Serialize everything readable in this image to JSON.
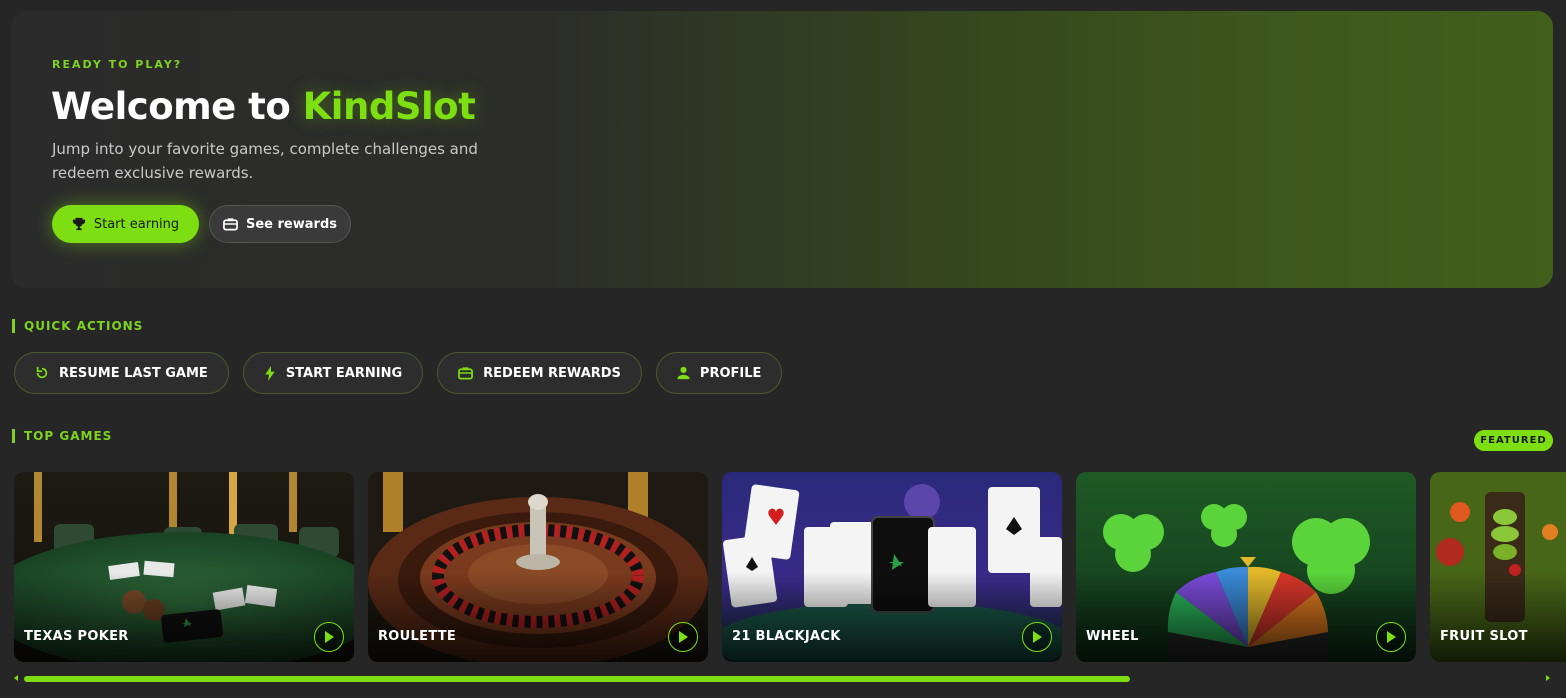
{
  "hero": {
    "eyebrow": "READY TO PLAY?",
    "title_prefix": "Welcome to ",
    "title_brand": "KindSlot",
    "subtitle": "Jump into your favorite games, complete challenges and redeem exclusive rewards.",
    "primary_button": {
      "label": "Start earning",
      "icon": "trophy-icon"
    },
    "secondary_button": {
      "label": "See rewards",
      "icon": "gift-icon"
    }
  },
  "quick_actions": {
    "heading": "QUICK ACTIONS",
    "items": [
      {
        "label": "RESUME LAST GAME",
        "icon": "refresh-icon"
      },
      {
        "label": "START EARNING",
        "icon": "bolt-icon"
      },
      {
        "label": "REDEEM REWARDS",
        "icon": "gift-icon"
      },
      {
        "label": "PROFILE",
        "icon": "user-icon"
      }
    ]
  },
  "top_games": {
    "heading": "TOP GAMES",
    "badge": "FEATURED",
    "games": [
      {
        "title": "TEXAS POKER"
      },
      {
        "title": "ROULETTE"
      },
      {
        "title": "21 BLACKJACK"
      },
      {
        "title": "WHEEL"
      },
      {
        "title": "FRUIT SLOT"
      }
    ],
    "scroll_fraction": 0.72
  },
  "colors": {
    "accent": "#7ddf12",
    "background": "#262626"
  }
}
